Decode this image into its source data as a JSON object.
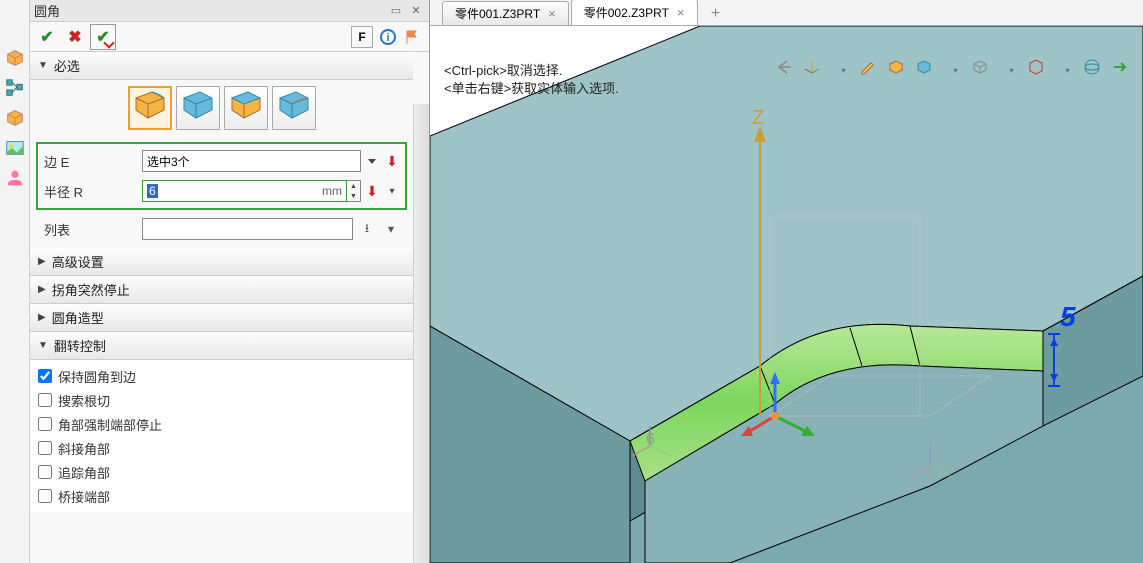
{
  "panel": {
    "title": "圆角",
    "f_button": "F",
    "sections": {
      "required": "必选",
      "advanced": "高级设置",
      "corner_stop": "拐角突然停止",
      "fillet_shape": "圆角造型",
      "flip_control": "翻转控制"
    },
    "edge_label": "边 E",
    "edge_value": "选中3个",
    "radius_label": "半径 R",
    "radius_value": "6",
    "radius_unit": "mm",
    "list_label": "列表",
    "checks": {
      "keep_fillet": "保持圆角到边",
      "search_undercut": "搜索根切",
      "force_end_stop": "角部强制端部停止",
      "miter_corner": "斜接角部",
      "trace_corner": "追踪角部",
      "bridge_corner": "桥接端部"
    }
  },
  "tabs": [
    {
      "label": "零件001.Z3PRT",
      "active": false
    },
    {
      "label": "零件002.Z3PRT",
      "active": true
    }
  ],
  "hints": {
    "line1": "<Ctrl-pick>取消选择.",
    "line2": "<单击右键>获取实体输入选项."
  },
  "viewport": {
    "z_label": "Z",
    "dim_value": "5",
    "triad_label": "6"
  }
}
